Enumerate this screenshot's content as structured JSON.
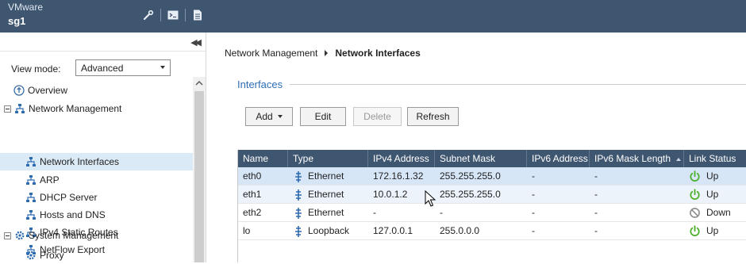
{
  "topbar": {
    "vendor": "VMware",
    "host": "sg1",
    "icons": [
      "wrench-icon",
      "terminal-icon",
      "document-icon"
    ]
  },
  "sidebar": {
    "collapse_icon": "double-chevron-left-icon",
    "view_mode_label": "View mode:",
    "view_mode_value": "Advanced",
    "tree": [
      {
        "label": "Overview",
        "icon": "overview-icon"
      },
      {
        "label": "Network Management",
        "icon": "network-icon",
        "expanded": true
      },
      {
        "label": "Network Interfaces",
        "icon": "network-icon",
        "selected": true
      },
      {
        "label": "ARP",
        "icon": "network-icon"
      },
      {
        "label": "DHCP Server",
        "icon": "network-icon"
      },
      {
        "label": "Hosts and DNS",
        "icon": "network-icon"
      },
      {
        "label": "IPv4 Static Routes",
        "icon": "network-icon"
      },
      {
        "label": "NetFlow Export",
        "icon": "network-icon"
      },
      {
        "label": "System Management",
        "icon": "gear-icon",
        "expanded": true
      },
      {
        "label": "Proxy",
        "icon": "gear-icon"
      }
    ]
  },
  "main": {
    "breadcrumb": {
      "parent": "Network Management",
      "current": "Network Interfaces"
    },
    "section_title": "Interfaces",
    "buttons": {
      "add": "Add",
      "edit": "Edit",
      "delete": "Delete",
      "refresh": "Refresh"
    },
    "table": {
      "columns": [
        "Name",
        "Type",
        "IPv4 Address",
        "Subnet Mask",
        "IPv6 Address",
        "IPv6 Mask Length",
        "Link Status"
      ],
      "rows": [
        {
          "name": "eth0",
          "type": "Ethernet",
          "ipv4": "172.16.1.32",
          "mask": "255.255.255.0",
          "ipv6": "-",
          "ipv6_len": "-",
          "status": "Up"
        },
        {
          "name": "eth1",
          "type": "Ethernet",
          "ipv4": "10.0.1.2",
          "mask": "255.255.255.0",
          "ipv6": "-",
          "ipv6_len": "-",
          "status": "Up"
        },
        {
          "name": "eth2",
          "type": "Ethernet",
          "ipv4": "-",
          "mask": "-",
          "ipv6": "-",
          "ipv6_len": "-",
          "status": "Down"
        },
        {
          "name": "lo",
          "type": "Loopback",
          "ipv4": "127.0.0.1",
          "mask": "255.0.0.0",
          "ipv6": "-",
          "ipv6_len": "-",
          "status": "Up"
        }
      ]
    }
  },
  "colors": {
    "header_bg": "#3f5670",
    "accent": "#2d6db5",
    "status_up": "#4caf2a",
    "status_down": "#8c8c8c",
    "selected_row": "#d6e6f7"
  }
}
